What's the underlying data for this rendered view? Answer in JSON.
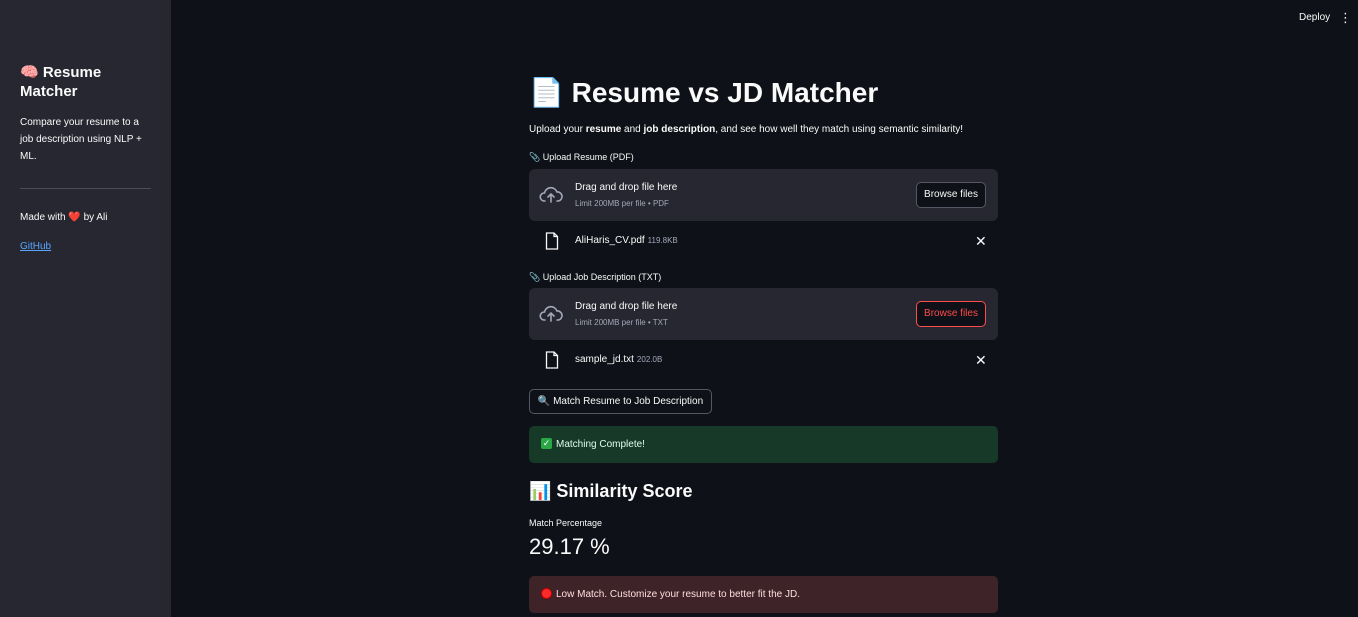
{
  "sidebar": {
    "title": "🧠 Resume Matcher",
    "description": "Compare your resume to a job description using NLP + ML.",
    "made_with_prefix": "Made with",
    "heart": "❤️",
    "made_with_suffix": "by Ali",
    "github_link": "GitHub"
  },
  "topbar": {
    "deploy_label": "Deploy",
    "menu_icon": "⋮"
  },
  "main": {
    "title": "📄 Resume vs JD Matcher",
    "subtitle_parts": {
      "p1": "Upload your ",
      "b1": "resume",
      "p2": " and ",
      "b2": "job description",
      "p3": ", and see how well they match using semantic similarity!"
    },
    "resume_upload": {
      "label": "📎 Upload Resume (PDF)",
      "drop_text": "Drag and drop file here",
      "limit_text": "Limit 200MB per file • PDF",
      "browse_label": "Browse files",
      "file_name": "AliHaris_CV.pdf",
      "file_size": "119.8KB"
    },
    "jd_upload": {
      "label": "📎 Upload Job Description (TXT)",
      "drop_text": "Drag and drop file here",
      "limit_text": "Limit 200MB per file • TXT",
      "browse_label": "Browse files",
      "file_name": "sample_jd.txt",
      "file_size": "202.0B"
    },
    "match_button": "🔍 Match Resume to Job Description",
    "success_message": "Matching Complete!",
    "score_section_title": "📊 Similarity Score",
    "metric_label": "Match Percentage",
    "metric_value": "29.17 %",
    "error_message": "Low Match. Customize your resume to better fit the JD."
  },
  "colors": {
    "background": "#0e1117",
    "sidebar": "#262730",
    "accent_red": "#ff4b4b",
    "success_bg": "#173928",
    "error_bg": "#3e2428",
    "link": "#58a6ff"
  }
}
